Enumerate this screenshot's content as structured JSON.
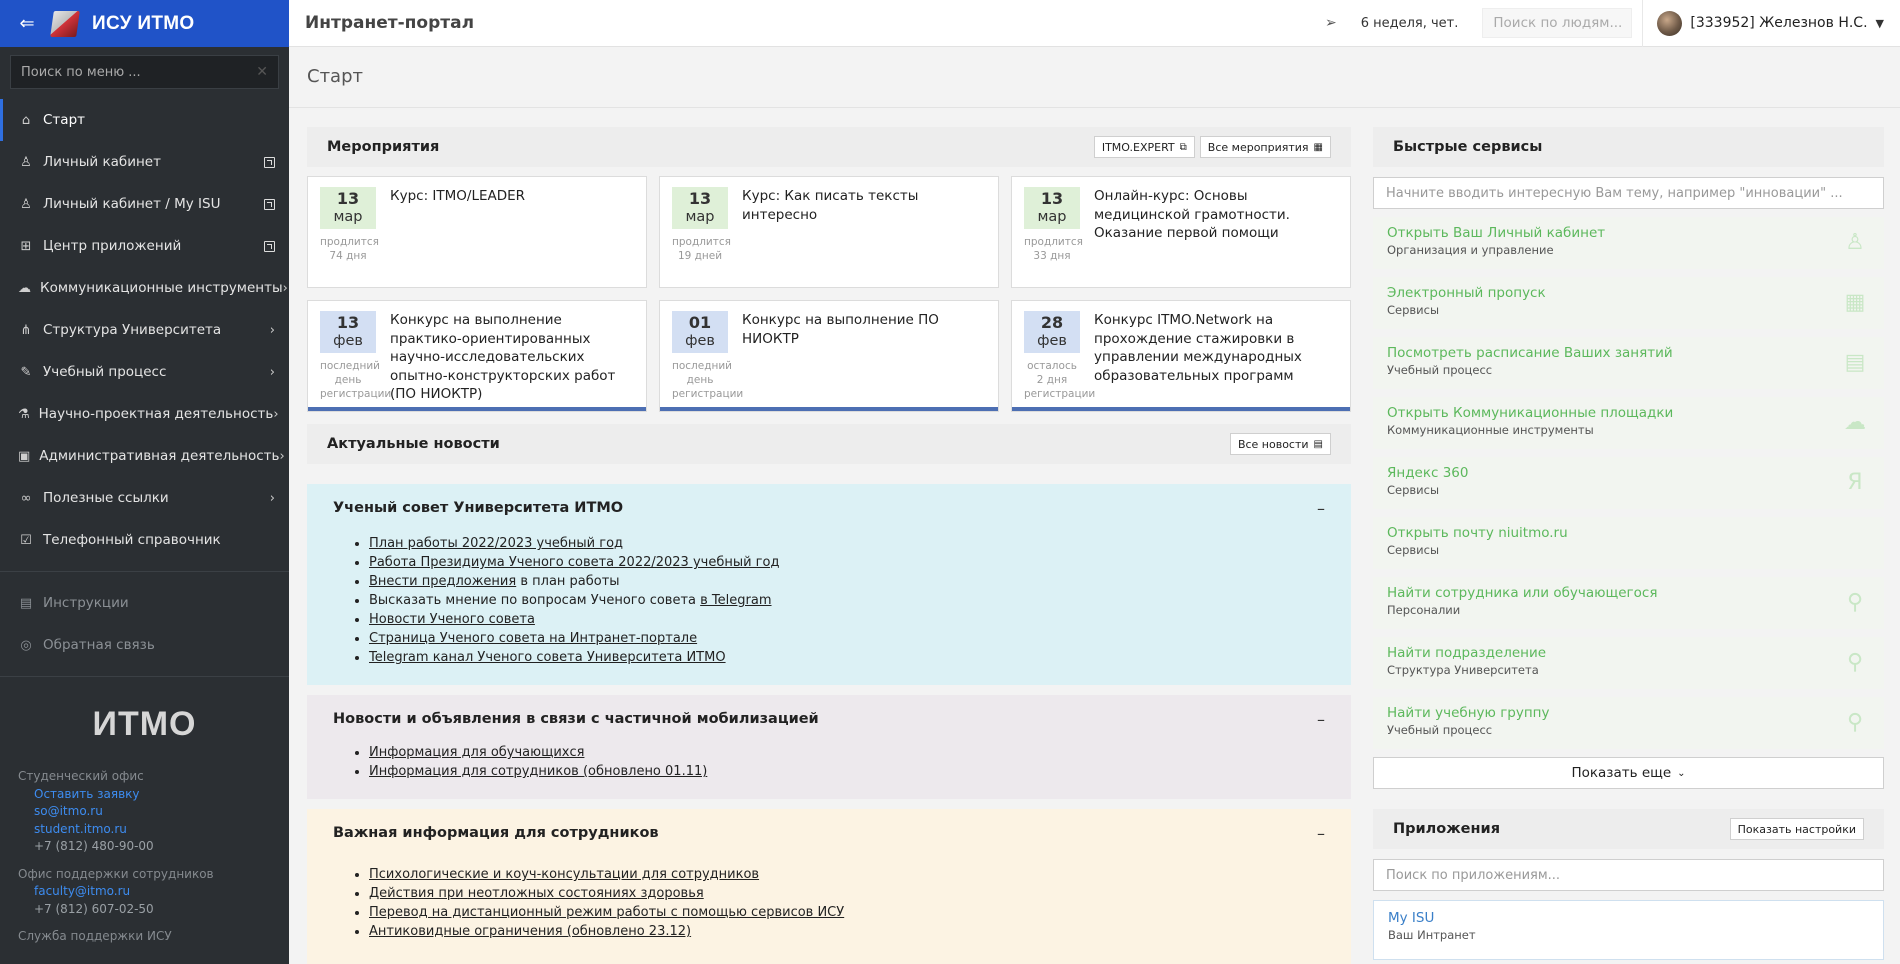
{
  "sidebar": {
    "brand": "ИСУ ИТМО",
    "search_placeholder": "Поиск по меню ...",
    "items": [
      {
        "label": "Старт"
      },
      {
        "label": "Личный кабинет"
      },
      {
        "label": "Личный кабинет / My ISU"
      },
      {
        "label": "Центр приложений"
      },
      {
        "label": "Коммуникационные инструменты"
      },
      {
        "label": "Структура Университета"
      },
      {
        "label": "Учебный процесс"
      },
      {
        "label": "Научно-проектная деятельность"
      },
      {
        "label": "Административная деятельность"
      },
      {
        "label": "Полезные ссылки"
      },
      {
        "label": "Телефонный справочник"
      }
    ],
    "secondary": [
      {
        "label": "Инструкции"
      },
      {
        "label": "Обратная связь"
      }
    ],
    "logo_text": "ИTMO",
    "student_office": {
      "heading": "Студенческий офис",
      "links": [
        "Оставить заявку",
        "so@itmo.ru",
        "student.itmo.ru"
      ],
      "phone": "+7 (812) 480-90-00"
    },
    "staff_office": {
      "heading": "Офис поддержки сотрудников",
      "links": [
        "faculty@itmo.ru"
      ],
      "phone": "+7 (812) 607-02-50"
    },
    "isu_support": {
      "heading": "Служба поддержки ИСУ"
    }
  },
  "topbar": {
    "title": "Интранет-портал",
    "week": "6 неделя, чет.",
    "people_search_placeholder": "Поиск по людям...",
    "user": "[333952] Железнов Н.С."
  },
  "page": {
    "title": "Старт"
  },
  "events": {
    "title": "Мероприятия",
    "btn_expert": "ITMO.EXPERT",
    "btn_all": "Все мероприятия",
    "items": [
      {
        "day": "13",
        "month": "мар",
        "meta1": "продлится",
        "meta2": "74 дня",
        "title": "Курс: ITMO/LEADER"
      },
      {
        "day": "13",
        "month": "мар",
        "meta1": "продлится",
        "meta2": "19 дней",
        "title": "Курс: Как писать тексты интересно"
      },
      {
        "day": "13",
        "month": "мар",
        "meta1": "продлится",
        "meta2": "33 дня",
        "title": "Онлайн-курс: Основы медицинской грамотности. Оказание первой помощи"
      },
      {
        "day": "13",
        "month": "фев",
        "meta1": "последний",
        "meta2": "день регистрации",
        "title": "Конкурс на выполнение практико-ориентированных научно-исследовательских опытно-конструкторских работ (ПО НИОКТР)"
      },
      {
        "day": "01",
        "month": "фев",
        "meta1": "последний",
        "meta2": "день регистрации",
        "title": "Конкурс на выполнение ПО НИОКТР"
      },
      {
        "day": "28",
        "month": "фев",
        "meta1": "осталось",
        "meta2": "2 дня регистрации",
        "title": "Конкурс ITMO.Network на прохождение стажировки в управлении международных образовательных программ"
      }
    ]
  },
  "news": {
    "title": "Актуальные новости",
    "btn_all": "Все новости",
    "toggle": "–",
    "blocks": [
      {
        "title": "Ученый совет Университета ИТМО",
        "items": [
          {
            "link": "План работы 2022/2023 учебный год",
            "rest": ""
          },
          {
            "link": "Работа Президиума Ученого совета 2022/2023 учебный год",
            "rest": ""
          },
          {
            "link": "Внести предложения",
            "rest": " в план работы"
          },
          {
            "pre": "Высказать мнение по вопросам Ученого совета ",
            "link": "в Telegram"
          },
          {
            "link": "Новости Ученого совета",
            "rest": ""
          },
          {
            "link": "Страница Ученого совета на Интранет-портале",
            "rest": ""
          },
          {
            "link": "Telegram канал Ученого совета Университета ИТМО",
            "rest": ""
          }
        ]
      },
      {
        "title": "Новости и объявления в связи с частичной мобилизацией",
        "items": [
          {
            "link": "Информация для обучающихся"
          },
          {
            "link": "Информация для сотрудников (обновлено 01.11)"
          }
        ]
      },
      {
        "title": "Важная информация для сотрудников",
        "items": [
          {
            "link": "Психологические и коуч-консультации для сотрудников"
          },
          {
            "link": "Действия при неотложных состояниях здоровья"
          },
          {
            "link": "Перевод на дистанционный режим работы с помощью сервисов ИСУ"
          },
          {
            "link": "Антиковидные ограничения (обновлено 23.12)"
          }
        ]
      }
    ]
  },
  "quick": {
    "title": "Быстрые сервисы",
    "search_placeholder": "Начните вводить интересную Вам тему, например \"инновации\" ...",
    "items": [
      {
        "title": "Открыть Ваш Личный кабинет",
        "sub": "Организация и управление",
        "icon": "user-icon"
      },
      {
        "title": "Электронный пропуск",
        "sub": "Сервисы",
        "icon": "qr-icon"
      },
      {
        "title": "Посмотреть расписание Ваших занятий",
        "sub": "Учебный процесс",
        "icon": "calendar-icon"
      },
      {
        "title": "Открыть Коммуникационные площадки",
        "sub": "Коммуникационные инструменты",
        "icon": "chat-icon"
      },
      {
        "title": "Яндекс 360",
        "sub": "Сервисы",
        "icon": "yandex-icon",
        "glyph": "Я"
      },
      {
        "title": "Открыть почту niuitmo.ru",
        "sub": "Сервисы",
        "icon": "mail-icon"
      },
      {
        "title": "Найти сотрудника или обучающегося",
        "sub": "Персоналии",
        "icon": "search-icon"
      },
      {
        "title": "Найти подразделение",
        "sub": "Структура Университета",
        "icon": "search-icon"
      },
      {
        "title": "Найти учебную группу",
        "sub": "Учебный процесс",
        "icon": "search-icon"
      }
    ],
    "more": "Показать еще"
  },
  "apps": {
    "title": "Приложения",
    "settings_btn": "Показать настройки",
    "search_placeholder": "Поиск по приложениям...",
    "first": {
      "title": "My ISU",
      "sub": "Ваш Интранет"
    }
  },
  "colors": {
    "brand_blue": "#2053c8",
    "sidebar_bg": "#2b2f33",
    "green_text": "#5cb85c"
  }
}
